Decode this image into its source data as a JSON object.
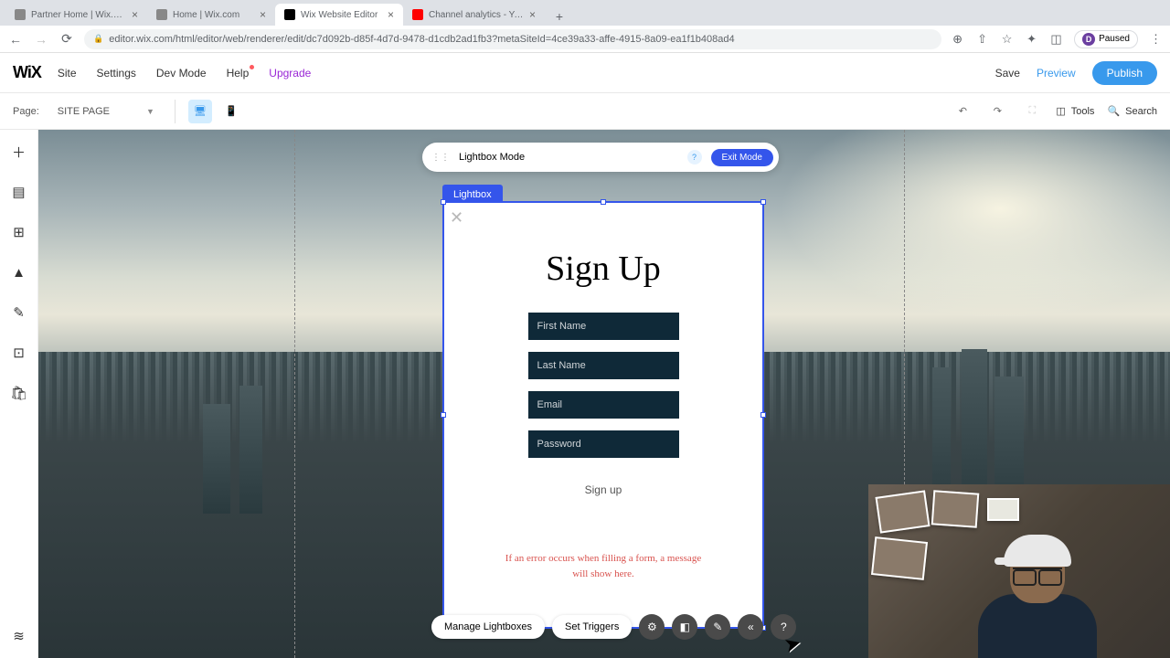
{
  "browser": {
    "tabs": [
      {
        "title": "Partner Home | Wix.com"
      },
      {
        "title": "Home | Wix.com"
      },
      {
        "title": "Wix Website Editor"
      },
      {
        "title": "Channel analytics - YouTube S"
      }
    ],
    "url": "editor.wix.com/html/editor/web/renderer/edit/dc7d092b-d85f-4d7d-9478-d1cdb2ad1fb3?metaSiteId=4ce39a33-affe-4915-8a09-ea1f1b408ad4",
    "paused": "Paused",
    "profile_initial": "D"
  },
  "wix_menu": {
    "logo": "WiX",
    "items": {
      "site": "Site",
      "settings": "Settings",
      "devmode": "Dev Mode",
      "help": "Help",
      "upgrade": "Upgrade"
    },
    "actions": {
      "save": "Save",
      "preview": "Preview",
      "publish": "Publish"
    }
  },
  "secbar": {
    "page_label": "Page:",
    "page_value": "SITE PAGE",
    "tools": "Tools",
    "search": "Search"
  },
  "lightbox_bar": {
    "title": "Lightbox Mode",
    "exit": "Exit Mode"
  },
  "lightbox": {
    "tag": "Lightbox",
    "form": {
      "title": "Sign Up",
      "fields": {
        "first": "First Name",
        "last": "Last Name",
        "email": "Email",
        "password": "Password"
      },
      "submit": "Sign up",
      "error": "If an error occurs when filling a form, a message will show here."
    }
  },
  "bottom_actions": {
    "manage": "Manage Lightboxes",
    "triggers": "Set Triggers"
  }
}
